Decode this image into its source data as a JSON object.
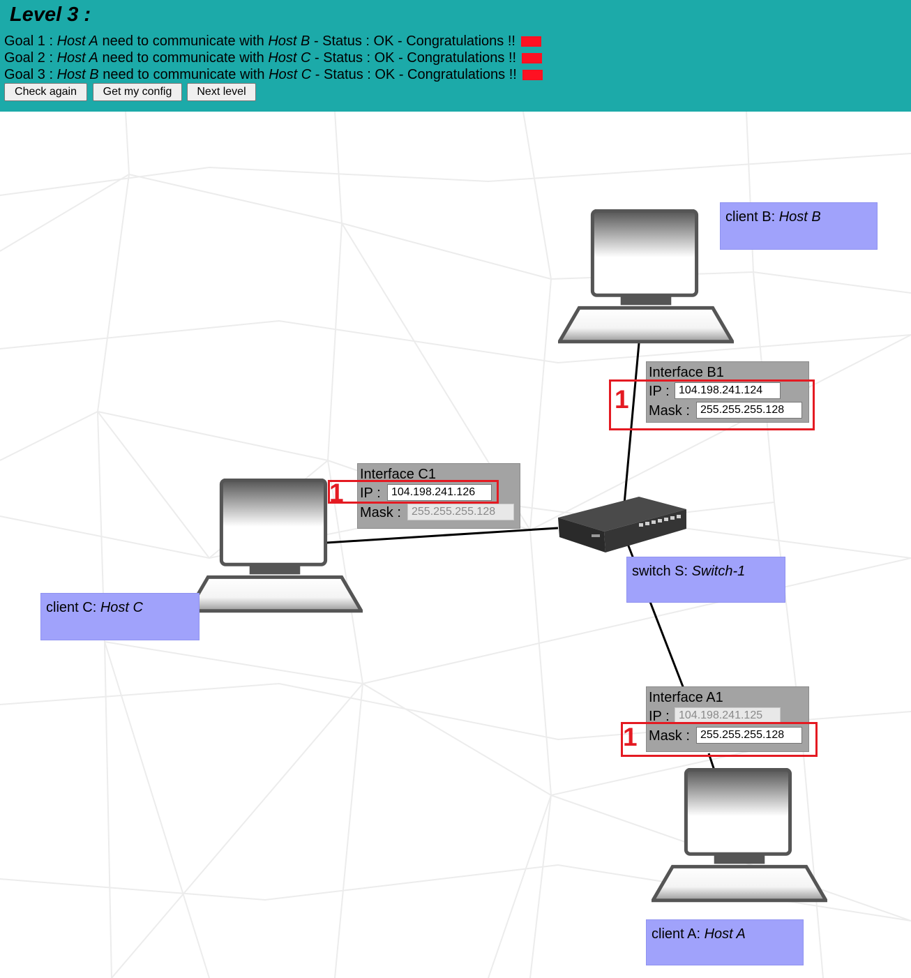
{
  "header": {
    "title": "Level 3 :",
    "status_color": "#ff1122",
    "goals": [
      {
        "prefix": "Goal 1 : ",
        "host_from": "Host A",
        "middle": " need to communicate with ",
        "host_to": "Host B",
        "status": " - Status : OK - Congratulations !!"
      },
      {
        "prefix": "Goal 2 : ",
        "host_from": "Host A",
        "middle": " need to communicate with ",
        "host_to": "Host C",
        "status": " - Status : OK - Congratulations !!"
      },
      {
        "prefix": "Goal 3 : ",
        "host_from": "Host B",
        "middle": " need to communicate with ",
        "host_to": "Host C",
        "status": " - Status : OK - Congratulations !!"
      }
    ],
    "buttons": {
      "check_again": "Check again",
      "get_config": "Get my config",
      "next_level": "Next level"
    }
  },
  "nodes": {
    "host_b": {
      "prefix": "client B: ",
      "name": "Host B"
    },
    "host_c": {
      "prefix": "client C: ",
      "name": "Host C"
    },
    "host_a": {
      "prefix": "client A: ",
      "name": "Host A"
    },
    "switch": {
      "prefix": "switch S: ",
      "name": "Switch-1"
    }
  },
  "interfaces": {
    "b1": {
      "title": "Interface B1",
      "ip_label": "IP :",
      "ip": "104.198.241.124",
      "mask_label": "Mask :",
      "mask": "255.255.255.128"
    },
    "c1": {
      "title": "Interface C1",
      "ip_label": "IP :",
      "ip": "104.198.241.126",
      "mask_label": "Mask :",
      "mask": "255.255.255.128"
    },
    "a1": {
      "title": "Interface A1",
      "ip_label": "IP :",
      "ip": "104.198.241.125",
      "mask_label": "Mask :",
      "mask": "255.255.255.128"
    }
  },
  "highlights": {
    "b1": "1",
    "c1": "1",
    "a1": "1"
  },
  "colors": {
    "header_bg": "#1caaa9",
    "label_bg": "#a0a2fb",
    "interface_bg": "#a3a3a3",
    "highlight": "#e41a22"
  }
}
